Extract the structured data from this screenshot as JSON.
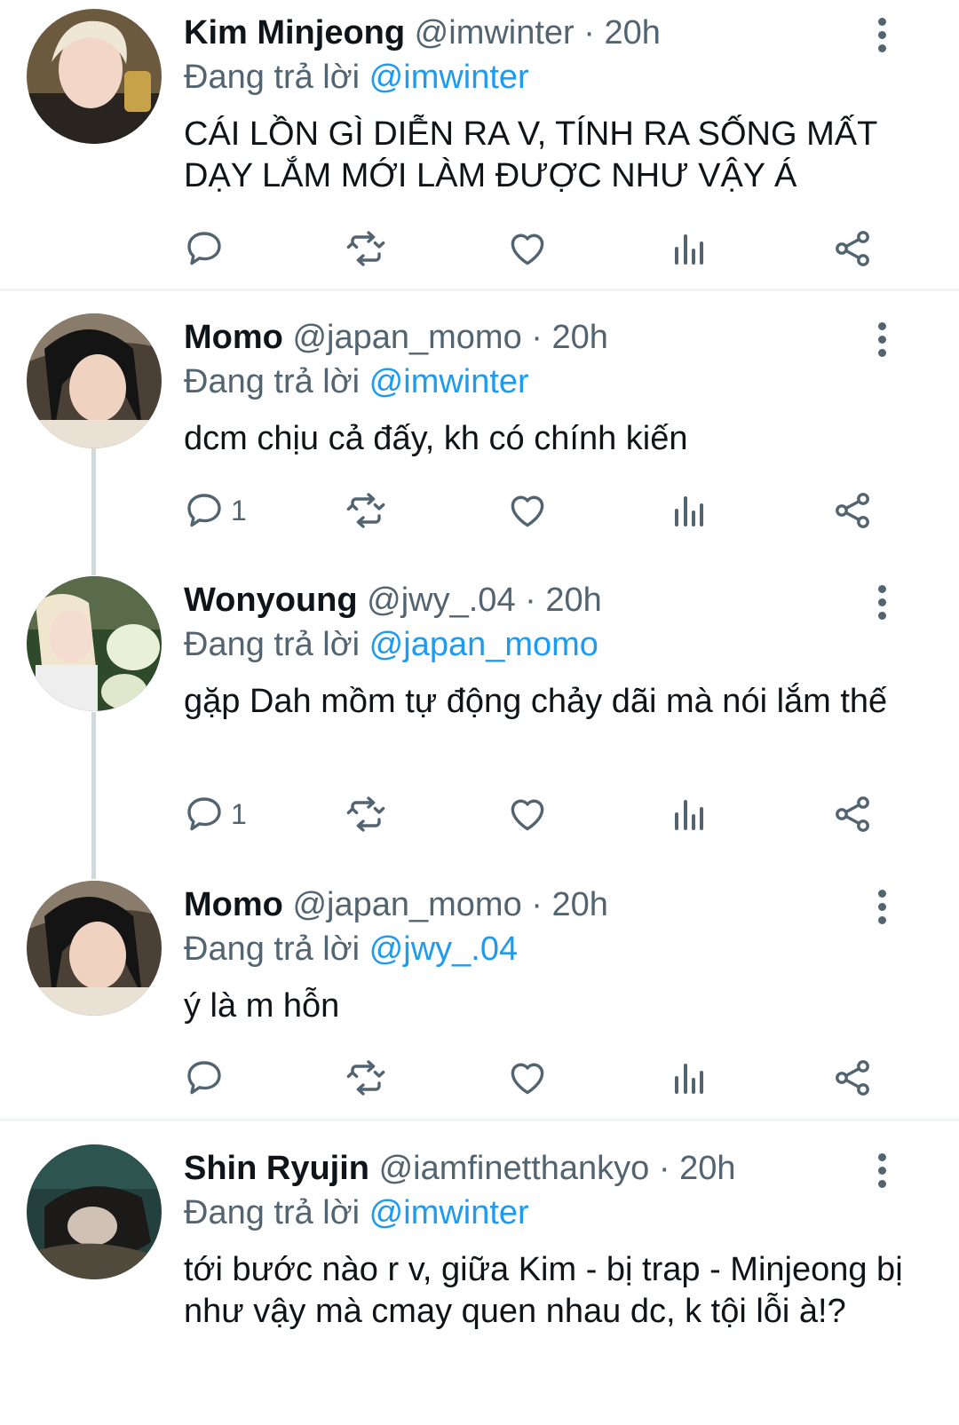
{
  "tweets": [
    {
      "name": "Kim Minjeong",
      "handle": "@imwinter",
      "time": "20h",
      "reply_prefix": "Đang trả lời",
      "reply_to": "@imwinter",
      "text": "CÁI LỒN GÌ DIỄN RA V, TÍNH RA SỐNG MẤT DẠY LẮM MỚI LÀM ĐƯỢC NHƯ VẬY Á",
      "reply_count": ""
    },
    {
      "name": "Momo",
      "handle": "@japan_momo",
      "time": "20h",
      "reply_prefix": "Đang trả lời",
      "reply_to": "@imwinter",
      "text": "dcm chịu cả đấy, kh có chính kiến",
      "reply_count": "1"
    },
    {
      "name": "Wonyoung",
      "handle": "@jwy_.04",
      "time": "20h",
      "reply_prefix": "Đang trả lời",
      "reply_to": "@japan_momo",
      "text": "gặp Dah mồm tự động chảy dãi mà nói lắm thế",
      "reply_count": "1"
    },
    {
      "name": "Momo",
      "handle": "@japan_momo",
      "time": "20h",
      "reply_prefix": "Đang trả lời",
      "reply_to": "@jwy_.04",
      "text": "ý là m hỗn",
      "reply_count": ""
    },
    {
      "name": "Shin Ryujin",
      "handle": "@iamfinetthankyo",
      "time": "20h",
      "reply_prefix": "Đang trả lời",
      "reply_to": "@imwinter",
      "text": "tới bước nào r v, giữa Kim - bị trap - Minjeong bị như vậy mà cmay quen nhau dc, k tội lỗi à!?",
      "reply_count": ""
    }
  ],
  "separator": "·",
  "icons": [
    "reply-icon",
    "retweet-icon",
    "like-icon",
    "views-icon",
    "share-icon",
    "more-icon"
  ],
  "colors": {
    "accent": "#1d9bf0",
    "muted": "#536471",
    "text": "#0f1419",
    "thread_line": "#cfd9de",
    "divider": "#eff3f4"
  }
}
